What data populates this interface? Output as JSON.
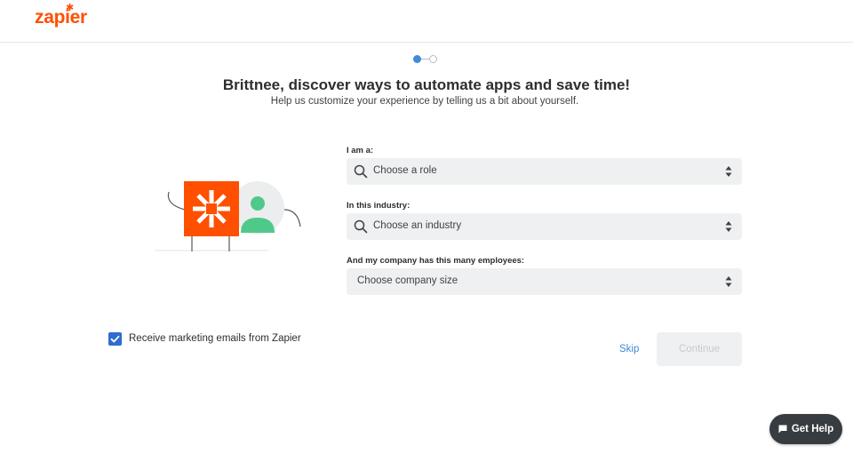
{
  "brand": {
    "logo_text": "zapier",
    "accent": "#ff4f00"
  },
  "stepper": {
    "current_step": 1,
    "total_steps": 2
  },
  "intro": {
    "title": "Brittnee, discover ways to automate apps and save time!",
    "subtitle": "Help us customize your experience by telling us a bit about yourself."
  },
  "form": {
    "role": {
      "label": "I am a:",
      "placeholder": "Choose a role",
      "icon": "search-icon"
    },
    "industry": {
      "label": "In this industry:",
      "placeholder": "Choose an industry",
      "icon": "search-icon"
    },
    "company_size": {
      "label": "And my company has this many employees:",
      "placeholder": "Choose company size"
    }
  },
  "marketing": {
    "checked": true,
    "label": "Receive marketing emails from Zapier"
  },
  "actions": {
    "skip_label": "Skip",
    "continue_label": "Continue"
  },
  "help": {
    "label": "Get Help",
    "icon": "chat-icon"
  },
  "colors": {
    "primary_blue": "#3d8bd9",
    "checkbox_blue": "#2e6ccf",
    "avatar_green": "#4fc98a",
    "field_bg": "#eff0f1"
  }
}
